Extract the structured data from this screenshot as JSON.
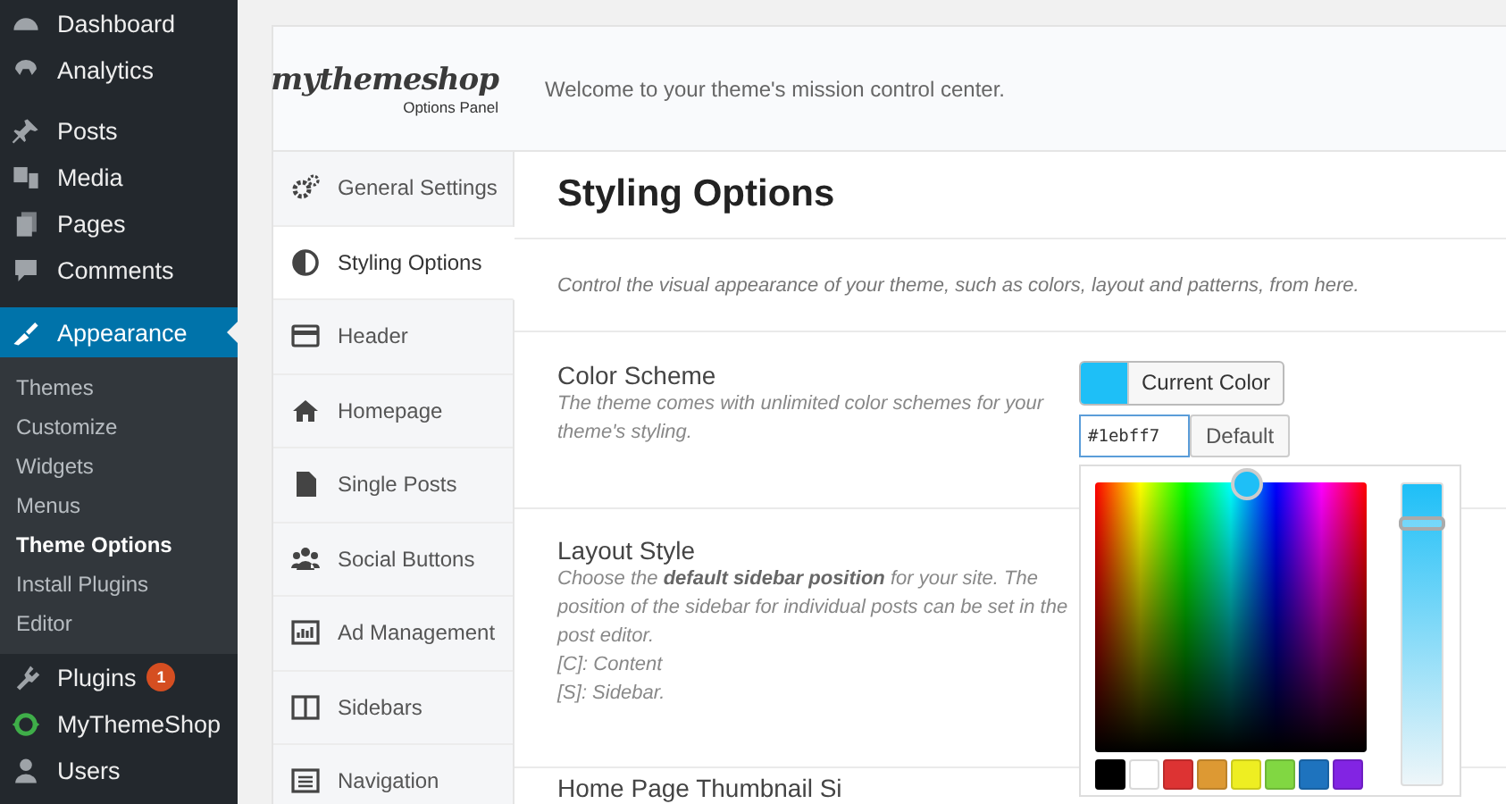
{
  "admin_menu": {
    "groups": [
      [
        {
          "label": "Dashboard",
          "selected": false
        },
        {
          "label": "Analytics",
          "selected": false
        }
      ],
      [
        {
          "label": "Posts",
          "selected": false
        },
        {
          "label": "Media",
          "selected": false
        },
        {
          "label": "Pages",
          "selected": false
        },
        {
          "label": "Comments",
          "selected": false
        }
      ],
      [
        {
          "label": "Appearance",
          "selected": true,
          "submenu": [
            {
              "label": "Themes",
              "selected": false
            },
            {
              "label": "Customize",
              "selected": false
            },
            {
              "label": "Widgets",
              "selected": false
            },
            {
              "label": "Menus",
              "selected": false
            },
            {
              "label": "Theme Options",
              "selected": true
            },
            {
              "label": "Install Plugins",
              "selected": false
            },
            {
              "label": "Editor",
              "selected": false
            }
          ]
        },
        {
          "label": "Plugins",
          "selected": false,
          "badge": "1"
        },
        {
          "label": "MyThemeShop",
          "selected": false
        },
        {
          "label": "Users",
          "selected": false
        }
      ]
    ]
  },
  "panel": {
    "logo": "mythemeshop",
    "logo_subtitle": "Options Panel",
    "welcome": "Welcome to your theme's mission control center.",
    "nav": [
      {
        "label": "General Settings",
        "selected": false
      },
      {
        "label": "Styling Options",
        "selected": true
      },
      {
        "label": "Header",
        "selected": false
      },
      {
        "label": "Homepage",
        "selected": false
      },
      {
        "label": "Single Posts",
        "selected": false
      },
      {
        "label": "Social Buttons",
        "selected": false
      },
      {
        "label": "Ad Management",
        "selected": false
      },
      {
        "label": "Sidebars",
        "selected": false
      },
      {
        "label": "Navigation",
        "selected": false
      }
    ],
    "title": "Styling Options",
    "intro": "Control the visual appearance of your theme, such as colors, layout and patterns, from here.",
    "options": [
      {
        "kind": "color",
        "label": "Color Scheme",
        "description": [
          "The theme comes with unlimited color schemes for your theme's styling."
        ],
        "button": "Current Color",
        "value": "#1ebff7",
        "default_button": "Default",
        "lightness": {
          "level": 0.87
        },
        "swatches": [
          {
            "color": "#000000"
          },
          {
            "color": "#ffffff"
          },
          {
            "color": "#dd3333"
          },
          {
            "color": "#dd9933"
          },
          {
            "color": "#eeee22"
          },
          {
            "color": "#81d742"
          },
          {
            "color": "#1e73be"
          },
          {
            "color": "#8224e3"
          }
        ]
      },
      {
        "kind": "text",
        "label": "Layout Style",
        "description": [
          "Choose the **default sidebar position** for your site. The position of the sidebar for individual posts can be set in the post editor.",
          "[C]: Content",
          "[S]: Sidebar."
        ]
      },
      {
        "kind": "text",
        "label": "Home Page Thumbnail Si"
      }
    ]
  }
}
